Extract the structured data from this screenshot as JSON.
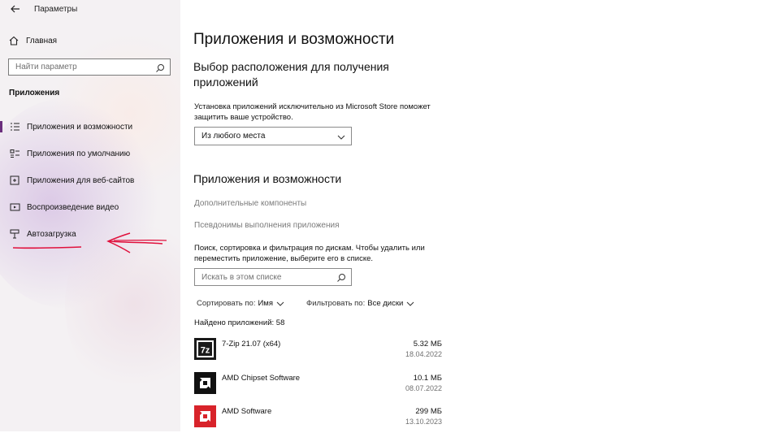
{
  "window": {
    "title": "Параметры"
  },
  "sidebar": {
    "home_label": "Главная",
    "search_placeholder": "Найти параметр",
    "section_title": "Приложения",
    "items": [
      {
        "label": "Приложения и возможности",
        "icon": "list-icon",
        "active": true
      },
      {
        "label": "Приложения по умолчанию",
        "icon": "default-apps-icon"
      },
      {
        "label": "Приложения для веб-сайтов",
        "icon": "web-apps-icon"
      },
      {
        "label": "Воспроизведение видео",
        "icon": "video-icon"
      },
      {
        "label": "Автозагрузка",
        "icon": "startup-icon"
      }
    ],
    "accent_color": "#6b2f7d",
    "annotation_color": "#e0103c"
  },
  "main": {
    "page_title": "Приложения и возможности",
    "source_heading": "Выбор расположения для получения приложений",
    "source_description": "Установка приложений исключительно из Microsoft Store поможет защитить ваше устройство.",
    "source_dropdown_value": "Из любого места",
    "apps_heading": "Приложения и возможности",
    "link_optional": "Дополнительные компоненты",
    "link_aliases": "Псевдонимы выполнения приложения",
    "search_description": "Поиск, сортировка и фильтрация по дискам. Чтобы удалить или переместить приложение, выберите его в списке.",
    "search_placeholder": "Искать в этом списке",
    "sort_label": "Сортировать по:",
    "sort_value": "Имя",
    "filter_label": "Фильтровать по:",
    "filter_value": "Все диски",
    "found_text": "Найдено приложений: 58",
    "apps": [
      {
        "name": "7-Zip 21.07 (x64)",
        "size": "5.32 МБ",
        "date": "18.04.2022",
        "logo": "7z"
      },
      {
        "name": "AMD Chipset Software",
        "size": "10.1 МБ",
        "date": "08.07.2022",
        "logo": "amd-black"
      },
      {
        "name": "AMD Software",
        "size": "299 МБ",
        "date": "13.10.2023",
        "logo": "amd-red"
      }
    ]
  }
}
